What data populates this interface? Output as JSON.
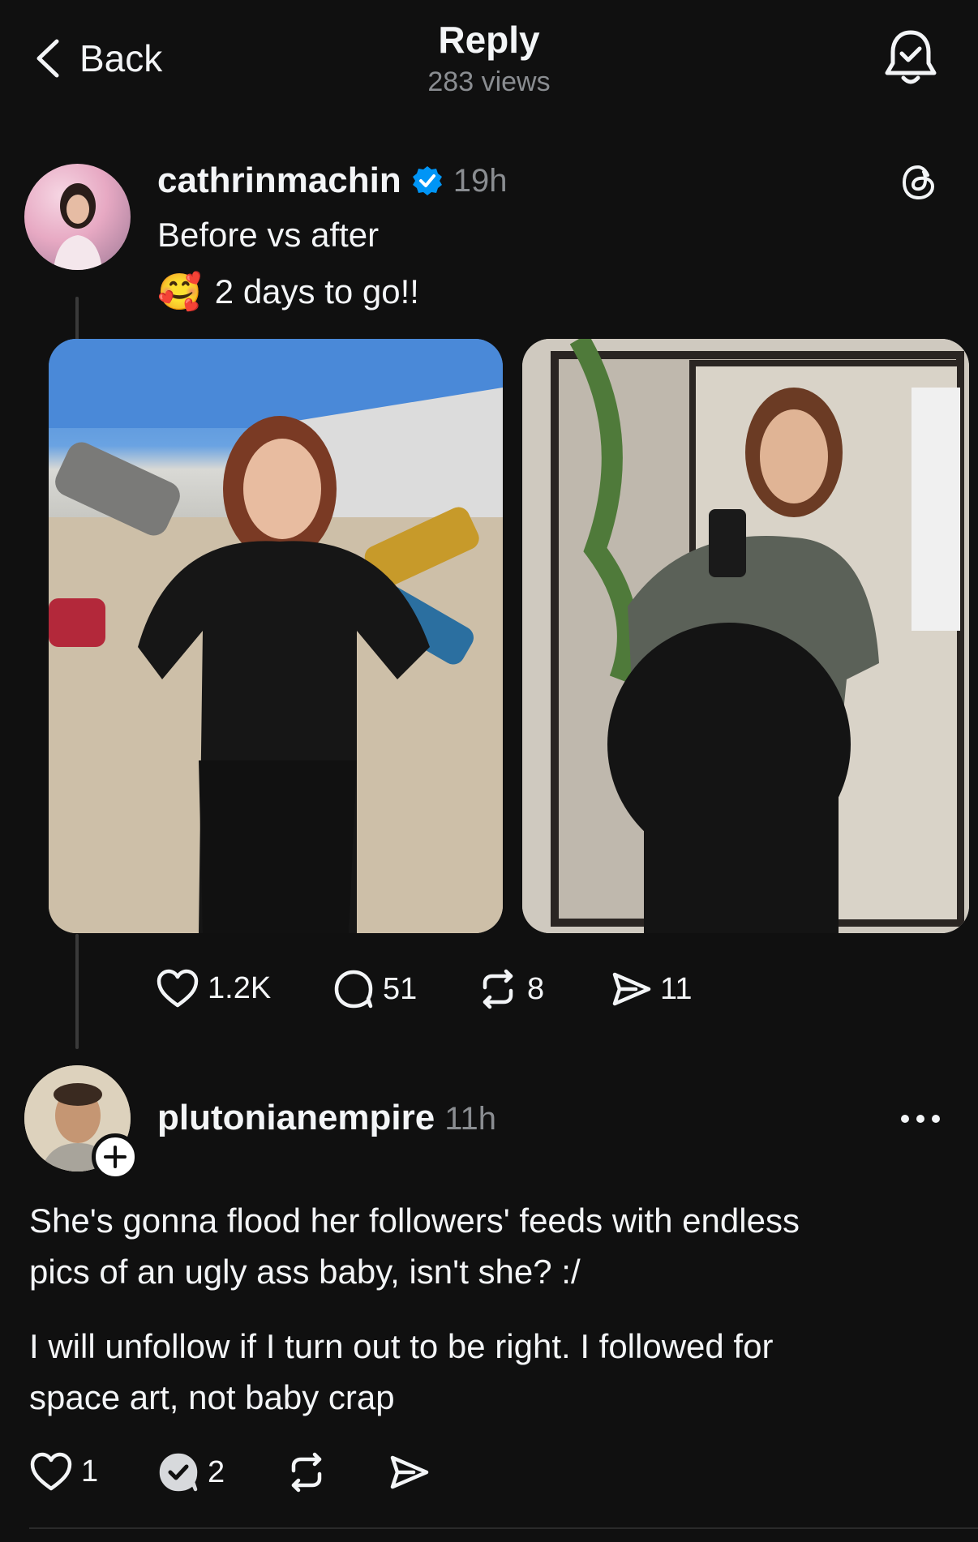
{
  "header": {
    "back_label": "Back",
    "title": "Reply",
    "subtitle": "283 views",
    "bell_icon": "bell-check-icon"
  },
  "post": {
    "username": "cathrinmachin",
    "verified": true,
    "time": "19h",
    "line1": "Before vs after",
    "emoji": "🥰",
    "line2": "2 days to go!!",
    "stats": {
      "likes": "1.2K",
      "comments": "51",
      "reposts": "8",
      "shares": "11"
    }
  },
  "reply": {
    "username": "plutonianempire",
    "time": "11h",
    "paragraph1_line1": "She's gonna flood her followers' feeds with endless",
    "paragraph1_line2": "pics of an ugly ass baby, isn't she? :/",
    "paragraph2_line1": "I will unfollow if I turn out to be right. I followed for",
    "paragraph2_line2": "space art, not baby crap",
    "stats": {
      "likes": "1",
      "comments": "2"
    }
  },
  "colors": {
    "background": "#101010",
    "text": "#f3f5f7",
    "muted": "#8a8d91",
    "verified": "#0095f6"
  }
}
